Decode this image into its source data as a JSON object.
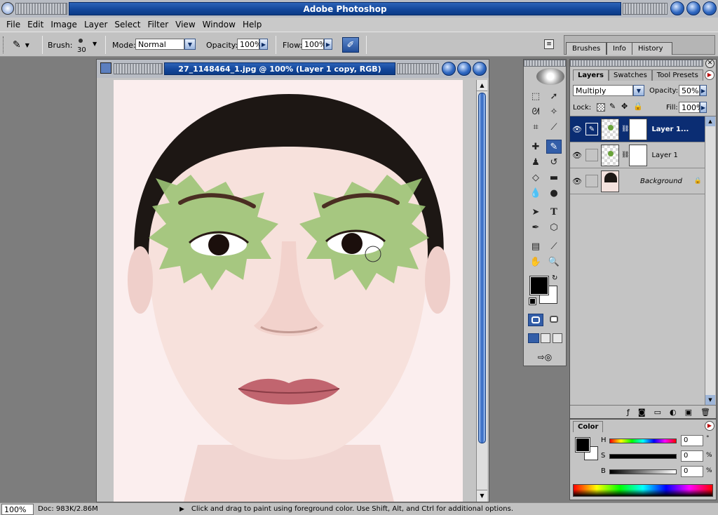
{
  "app": {
    "title": "Adobe Photoshop"
  },
  "menu": [
    "File",
    "Edit",
    "Image",
    "Layer",
    "Select",
    "Filter",
    "View",
    "Window",
    "Help"
  ],
  "options": {
    "brush_label": "Brush:",
    "brush_size": "30",
    "mode_label": "Mode:",
    "mode_value": "Normal",
    "opacity_label": "Opacity:",
    "opacity_value": "100%",
    "flow_label": "Flow:",
    "flow_value": "100%"
  },
  "palette_well": {
    "tabs": [
      "Brushes",
      "Info",
      "History"
    ]
  },
  "document": {
    "title": "27_1148464_1.jpg @ 100% (Layer 1 copy, RGB)"
  },
  "layers_panel": {
    "tabs": [
      "Layers",
      "Swatches",
      "Tool Presets"
    ],
    "blend_mode": "Multiply",
    "opacity_label": "Opacity:",
    "opacity_value": "50%",
    "lock_label": "Lock:",
    "fill_label": "Fill:",
    "fill_value": "100%",
    "layers": [
      {
        "name": "Layer 1...",
        "selected": true
      },
      {
        "name": "Layer 1",
        "selected": false
      },
      {
        "name": "Background",
        "selected": false
      }
    ]
  },
  "color_panel": {
    "tab": "Color",
    "channels": [
      {
        "label": "H",
        "value": "0",
        "unit": "°"
      },
      {
        "label": "S",
        "value": "0",
        "unit": "%"
      },
      {
        "label": "B",
        "value": "0",
        "unit": "%"
      }
    ]
  },
  "status": {
    "zoom": "100%",
    "doc": "Doc: 983K/2.86M",
    "hint": "Click and drag to paint using foreground color.  Use Shift, Alt, and Ctrl for additional options."
  },
  "colors": {
    "title_blue": "#13479b",
    "selection": "#0b2d73",
    "canvas_bg": "#fbeeee",
    "leaf": "#9cc475"
  }
}
